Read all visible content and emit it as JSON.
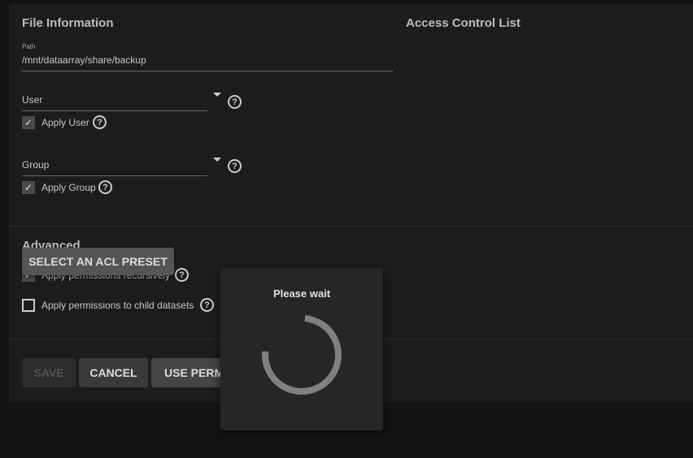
{
  "file_info": {
    "title": "File Information",
    "path_label": "Path",
    "path_value": "/mnt/dataarray/share/backup",
    "user_label": "User",
    "apply_user": "Apply User",
    "group_label": "Group",
    "apply_group": "Apply Group"
  },
  "acl": {
    "title": "Access Control List"
  },
  "advanced": {
    "title": "Advanced",
    "recursive": "Apply permissions recursively",
    "child": "Apply permissions to child datasets"
  },
  "buttons": {
    "preset": "SELECT AN ACL PRESET",
    "save": "SAVE",
    "cancel": "CANCEL",
    "use_perm": "USE PERMISSIONS EDITOR"
  },
  "dialog": {
    "title": "Please wait"
  },
  "help_glyph": "?",
  "check_glyph": "✓"
}
